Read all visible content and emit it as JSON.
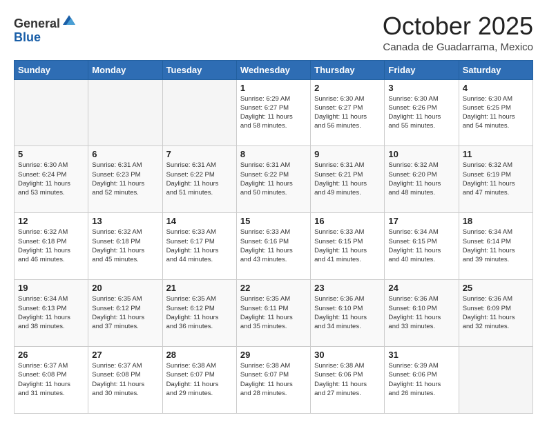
{
  "header": {
    "logo_general": "General",
    "logo_blue": "Blue",
    "month": "October 2025",
    "location": "Canada de Guadarrama, Mexico"
  },
  "weekdays": [
    "Sunday",
    "Monday",
    "Tuesday",
    "Wednesday",
    "Thursday",
    "Friday",
    "Saturday"
  ],
  "weeks": [
    [
      {
        "day": "",
        "info": ""
      },
      {
        "day": "",
        "info": ""
      },
      {
        "day": "",
        "info": ""
      },
      {
        "day": "1",
        "info": "Sunrise: 6:29 AM\nSunset: 6:27 PM\nDaylight: 11 hours\nand 58 minutes."
      },
      {
        "day": "2",
        "info": "Sunrise: 6:30 AM\nSunset: 6:27 PM\nDaylight: 11 hours\nand 56 minutes."
      },
      {
        "day": "3",
        "info": "Sunrise: 6:30 AM\nSunset: 6:26 PM\nDaylight: 11 hours\nand 55 minutes."
      },
      {
        "day": "4",
        "info": "Sunrise: 6:30 AM\nSunset: 6:25 PM\nDaylight: 11 hours\nand 54 minutes."
      }
    ],
    [
      {
        "day": "5",
        "info": "Sunrise: 6:30 AM\nSunset: 6:24 PM\nDaylight: 11 hours\nand 53 minutes."
      },
      {
        "day": "6",
        "info": "Sunrise: 6:31 AM\nSunset: 6:23 PM\nDaylight: 11 hours\nand 52 minutes."
      },
      {
        "day": "7",
        "info": "Sunrise: 6:31 AM\nSunset: 6:22 PM\nDaylight: 11 hours\nand 51 minutes."
      },
      {
        "day": "8",
        "info": "Sunrise: 6:31 AM\nSunset: 6:22 PM\nDaylight: 11 hours\nand 50 minutes."
      },
      {
        "day": "9",
        "info": "Sunrise: 6:31 AM\nSunset: 6:21 PM\nDaylight: 11 hours\nand 49 minutes."
      },
      {
        "day": "10",
        "info": "Sunrise: 6:32 AM\nSunset: 6:20 PM\nDaylight: 11 hours\nand 48 minutes."
      },
      {
        "day": "11",
        "info": "Sunrise: 6:32 AM\nSunset: 6:19 PM\nDaylight: 11 hours\nand 47 minutes."
      }
    ],
    [
      {
        "day": "12",
        "info": "Sunrise: 6:32 AM\nSunset: 6:18 PM\nDaylight: 11 hours\nand 46 minutes."
      },
      {
        "day": "13",
        "info": "Sunrise: 6:32 AM\nSunset: 6:18 PM\nDaylight: 11 hours\nand 45 minutes."
      },
      {
        "day": "14",
        "info": "Sunrise: 6:33 AM\nSunset: 6:17 PM\nDaylight: 11 hours\nand 44 minutes."
      },
      {
        "day": "15",
        "info": "Sunrise: 6:33 AM\nSunset: 6:16 PM\nDaylight: 11 hours\nand 43 minutes."
      },
      {
        "day": "16",
        "info": "Sunrise: 6:33 AM\nSunset: 6:15 PM\nDaylight: 11 hours\nand 41 minutes."
      },
      {
        "day": "17",
        "info": "Sunrise: 6:34 AM\nSunset: 6:15 PM\nDaylight: 11 hours\nand 40 minutes."
      },
      {
        "day": "18",
        "info": "Sunrise: 6:34 AM\nSunset: 6:14 PM\nDaylight: 11 hours\nand 39 minutes."
      }
    ],
    [
      {
        "day": "19",
        "info": "Sunrise: 6:34 AM\nSunset: 6:13 PM\nDaylight: 11 hours\nand 38 minutes."
      },
      {
        "day": "20",
        "info": "Sunrise: 6:35 AM\nSunset: 6:12 PM\nDaylight: 11 hours\nand 37 minutes."
      },
      {
        "day": "21",
        "info": "Sunrise: 6:35 AM\nSunset: 6:12 PM\nDaylight: 11 hours\nand 36 minutes."
      },
      {
        "day": "22",
        "info": "Sunrise: 6:35 AM\nSunset: 6:11 PM\nDaylight: 11 hours\nand 35 minutes."
      },
      {
        "day": "23",
        "info": "Sunrise: 6:36 AM\nSunset: 6:10 PM\nDaylight: 11 hours\nand 34 minutes."
      },
      {
        "day": "24",
        "info": "Sunrise: 6:36 AM\nSunset: 6:10 PM\nDaylight: 11 hours\nand 33 minutes."
      },
      {
        "day": "25",
        "info": "Sunrise: 6:36 AM\nSunset: 6:09 PM\nDaylight: 11 hours\nand 32 minutes."
      }
    ],
    [
      {
        "day": "26",
        "info": "Sunrise: 6:37 AM\nSunset: 6:08 PM\nDaylight: 11 hours\nand 31 minutes."
      },
      {
        "day": "27",
        "info": "Sunrise: 6:37 AM\nSunset: 6:08 PM\nDaylight: 11 hours\nand 30 minutes."
      },
      {
        "day": "28",
        "info": "Sunrise: 6:38 AM\nSunset: 6:07 PM\nDaylight: 11 hours\nand 29 minutes."
      },
      {
        "day": "29",
        "info": "Sunrise: 6:38 AM\nSunset: 6:07 PM\nDaylight: 11 hours\nand 28 minutes."
      },
      {
        "day": "30",
        "info": "Sunrise: 6:38 AM\nSunset: 6:06 PM\nDaylight: 11 hours\nand 27 minutes."
      },
      {
        "day": "31",
        "info": "Sunrise: 6:39 AM\nSunset: 6:06 PM\nDaylight: 11 hours\nand 26 minutes."
      },
      {
        "day": "",
        "info": ""
      }
    ]
  ]
}
